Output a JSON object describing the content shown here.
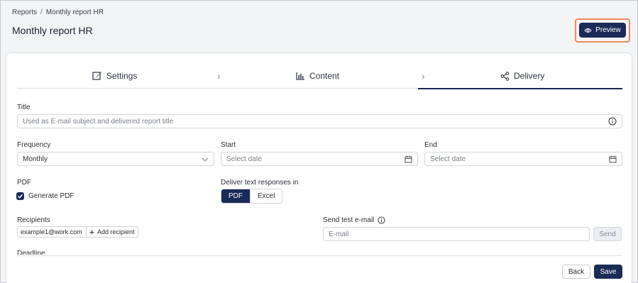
{
  "breadcrumb": {
    "root": "Reports",
    "separator": "/",
    "current": "Monthly report HR"
  },
  "page": {
    "title": "Monthly report HR"
  },
  "header": {
    "preview_label": "Preview"
  },
  "steps": [
    {
      "label": "Settings",
      "icon": "edit-icon",
      "active": false
    },
    {
      "label": "Content",
      "icon": "bar-chart-icon",
      "active": false
    },
    {
      "label": "Delivery",
      "icon": "share-icon",
      "active": true
    }
  ],
  "form": {
    "title_label": "Title",
    "title_placeholder": "Used as E-mail subject and delivered report title",
    "frequency_label": "Frequency",
    "frequency_value": "Monthly",
    "start_label": "Start",
    "start_placeholder": "Select date",
    "end_label": "End",
    "end_placeholder": "Select date",
    "pdf_label": "PDF",
    "generate_pdf_label": "Generate PDF",
    "generate_pdf_checked": true,
    "deliver_label": "Deliver text responses in",
    "deliver_options": [
      "PDF",
      "Excel"
    ],
    "deliver_selected": "PDF",
    "recipients_label": "Recipients",
    "recipients": [
      "example1@work.com"
    ],
    "add_recipient_label": "Add recipient",
    "test_email_label": "Send test e-mail",
    "test_email_placeholder": "E-mail",
    "send_label": "Send",
    "partial_label": "Deadline"
  },
  "footer": {
    "back_label": "Back",
    "save_label": "Save"
  },
  "colors": {
    "primary": "#1a2b57",
    "highlight": "#ef8a5a"
  }
}
